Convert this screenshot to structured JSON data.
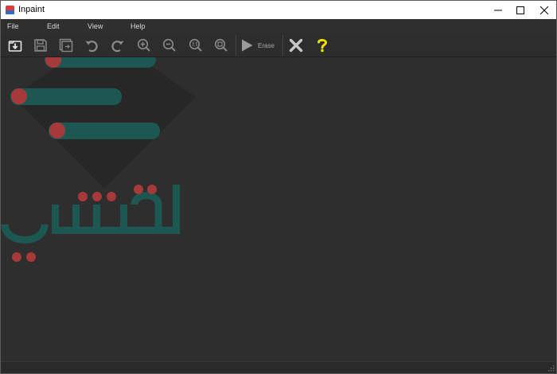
{
  "window": {
    "title": "Inpaint"
  },
  "menu": {
    "file": "File",
    "edit": "Edit",
    "view": "View",
    "help": "Help"
  },
  "toolbar": {
    "erase_label": "Erase",
    "icons": [
      "open-icon",
      "save-icon",
      "save-as-icon",
      "undo-icon",
      "redo-icon",
      "zoom-in-icon",
      "zoom-out-icon",
      "zoom-actual-icon",
      "zoom-fit-icon",
      "play-icon",
      "cancel-icon",
      "help-icon"
    ]
  },
  "colors": {
    "accent_help": "#f0e000",
    "canvas_bg": "#2e2e2e",
    "toolbar_bg": "#2d2d2d",
    "watermark_red": "#a63a3a",
    "watermark_teal": "#1d5751"
  }
}
